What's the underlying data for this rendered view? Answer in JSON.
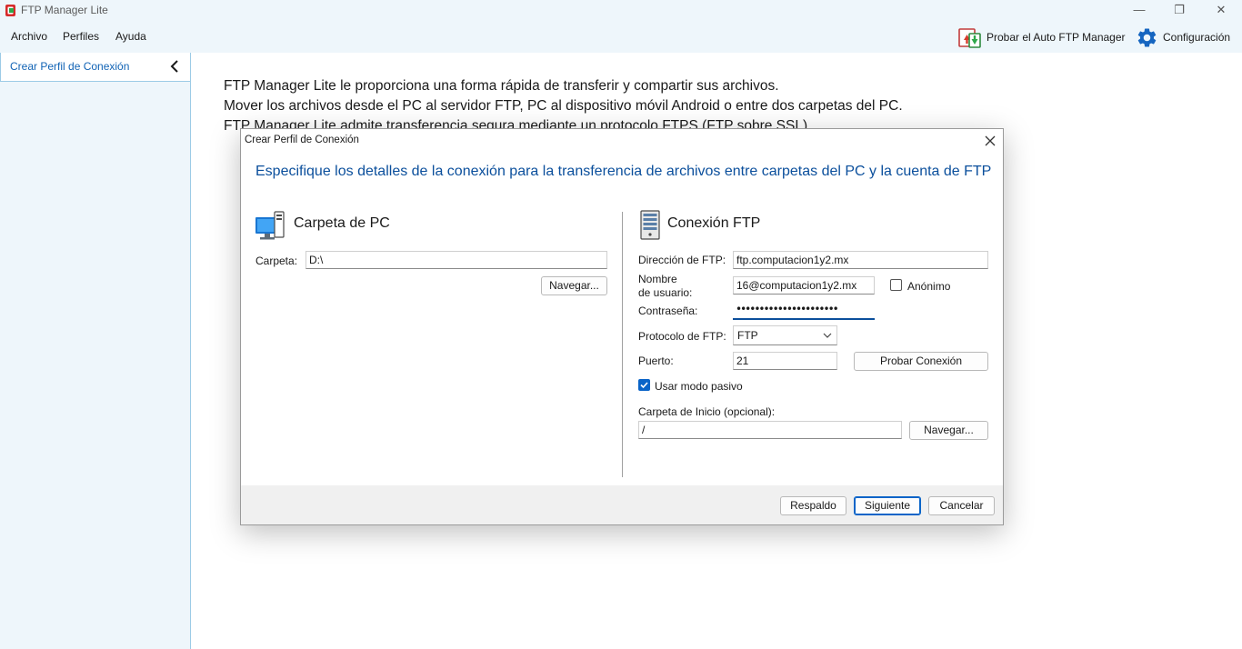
{
  "window": {
    "title": "FTP Manager Lite",
    "min_glyph": "—",
    "max_glyph": "❐",
    "close_glyph": "✕"
  },
  "menu": {
    "items": [
      "Archivo",
      "Perfiles",
      "Ayuda"
    ]
  },
  "toolbar": {
    "auto_ftp_label": "Probar el Auto FTP Manager",
    "auto_ftp_icon": "auto-ftp-icon",
    "settings_label": "Configuración",
    "settings_icon": "gear-icon"
  },
  "sidebar": {
    "header_label": "Crear Perfil de Conexión",
    "collapse_icon": "chevron-left-icon"
  },
  "intro": {
    "lines": [
      "FTP Manager Lite le proporciona una forma rápida de transferir y compartir sus archivos.",
      "Mover los archivos desde el PC al servidor FTP, PC al dispositivo móvil Android o entre dos carpetas del PC.",
      "FTP Manager Lite admite transferencia segura mediante un protocolo FTPS (FTP sobre SSL)."
    ]
  },
  "dialog": {
    "title": "Crear Perfil de Conexión",
    "heading": "Especifique los detalles de la conexión para la transferencia de archivos entre carpetas del PC y la cuenta de FTP",
    "pc": {
      "section_title": "Carpeta de PC",
      "folder_label": "Carpeta:",
      "folder_value": "D:\\",
      "browse_label": "Navegar..."
    },
    "ftp": {
      "section_title": "Conexión FTP",
      "address_label": "Dirección de FTP:",
      "address_value": "ftp.computacion1y2.mx",
      "username_label_1": "Nombre",
      "username_label_2": "de usuario:",
      "username_value": "16@computacion1y2.mx",
      "anonymous_label": "Anónimo",
      "anonymous_checked": false,
      "password_label": "Contraseña:",
      "password_masked": "••••••••••••••••••••••",
      "protocol_label": "Protocolo de FTP:",
      "protocol_value": "FTP",
      "port_label": "Puerto:",
      "port_value": "21",
      "test_label": "Probar Conexión",
      "passive_label": "Usar modo pasivo",
      "passive_checked": true,
      "start_folder_label": "Carpeta de Inicio (opcional):",
      "start_folder_value": "/",
      "browse_label": "Navegar..."
    },
    "footer": {
      "backup_label": "Respaldo",
      "next_label": "Siguiente",
      "cancel_label": "Cancelar"
    }
  },
  "colors": {
    "accent": "#0a64c8",
    "heading": "#0b4f9c",
    "link": "#1163b5",
    "chrome_bg": "#eef6fb"
  }
}
